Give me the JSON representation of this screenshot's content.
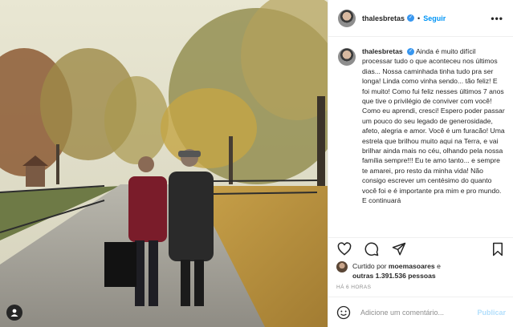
{
  "post": {
    "username": "thalesbretas",
    "verified": true,
    "separator": "•",
    "follow_label": "Seguir",
    "more_label": "•••",
    "caption": "Ainda é muito difícil processar tudo o que aconteceu nos últimos dias... Nossa caminhada tinha tudo pra ser longa! Linda como vinha sendo... tão feliz! E foi muito! Como fui feliz nesses últimos 7 anos que tive o privilégio de conviver com você! Como eu aprendi, cresci! Espero poder passar um pouco do seu legado de generosidade, afeto, alegria e amor. Você é um furacão! Uma estrela que brilhou muito aqui na Terra, e vai brilhar ainda mais no céu, olhando pela nossa família sempre!!! Eu te amo tanto... e sempre te amarei, pro resto da minha vida! Não consigo escrever um centésimo do quanto você foi e é importante pra mim e pro mundo. E continuará",
    "likes": {
      "prefix": "Curtido por",
      "user": "moemasoares",
      "conjunction": "e",
      "others": "outras 1.391.536 pessoas"
    },
    "time": "HÁ 6 HORAS",
    "comment_placeholder": "Adicione um comentário...",
    "publish_label": "Publicar"
  },
  "icons": {
    "like": "heart-icon",
    "comment": "comment-icon",
    "share": "share-icon",
    "save": "bookmark-icon",
    "emoji": "emoji-icon",
    "tag": "user-tag-icon"
  },
  "colors": {
    "link": "#0095f6",
    "verified": "#3897f0",
    "publish_disabled": "#b2dffc",
    "muted": "#8e8e8e"
  }
}
